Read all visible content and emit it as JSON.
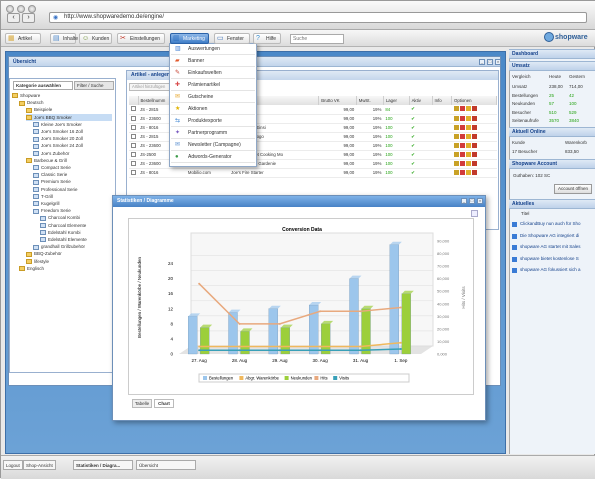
{
  "browser": {
    "url": "http://www.shopwaredemo.de/engine/"
  },
  "toolbar": {
    "items": [
      {
        "label": "Artikel",
        "icon": "box-icon"
      },
      {
        "label": "Inhalte",
        "icon": "doc-icon"
      },
      {
        "label": "Kunden",
        "icon": "users-icon"
      },
      {
        "label": "Einstellungen",
        "icon": "tools-icon"
      },
      {
        "label": "Marketing",
        "icon": "chart-icon"
      },
      {
        "label": "Fenster",
        "icon": "window-icon"
      },
      {
        "label": "Hilfe",
        "icon": "help-icon"
      }
    ],
    "search_placeholder": "Suche",
    "logo": "shopware"
  },
  "marketing_menu": [
    {
      "label": "Auswertungen",
      "icon": "chart-icon",
      "color": "#3b7bd3"
    },
    {
      "label": "Banner",
      "icon": "banner-icon",
      "color": "#e25a2d"
    },
    {
      "label": "Einkaufswelten",
      "icon": "pin-icon",
      "color": "#c43b2a"
    },
    {
      "label": "Prämienartikel",
      "icon": "gift-icon",
      "color": "#d94b4b"
    },
    {
      "label": "Gutscheine",
      "icon": "ticket-icon",
      "color": "#e7a52a"
    },
    {
      "label": "Aktionen",
      "icon": "star-icon",
      "color": "#e2b400"
    },
    {
      "label": "Produktexporte",
      "icon": "export-icon",
      "color": "#3f85d2"
    },
    {
      "label": "Partnerprogramm",
      "icon": "partner-icon",
      "color": "#7a5cc0"
    },
    {
      "label": "Newsletter (Campagne)",
      "icon": "mail-icon",
      "color": "#5a8fd0"
    },
    {
      "label": "Adwords-Generator",
      "icon": "adwords-icon",
      "color": "#3d9b4a"
    }
  ],
  "overview_window": {
    "title": "Übersicht"
  },
  "category_panel": {
    "tab_categories": "Kategorie auswählen",
    "tab_filter": "Filter / Suche",
    "tree": [
      {
        "label": "Shopware",
        "level": 0
      },
      {
        "label": "Deutsch",
        "level": 1
      },
      {
        "label": "Beispiele",
        "level": 2
      },
      {
        "label": "Joe's BBQ Smoker",
        "level": 2
      },
      {
        "label": "Kleine Joe's Smoker",
        "level": 3
      },
      {
        "label": "Joe's Smoker 16 Zoll",
        "level": 3
      },
      {
        "label": "Joe's Smoker 20 Zoll",
        "level": 3
      },
      {
        "label": "Joe's Smoker 24 Zoll",
        "level": 3
      },
      {
        "label": "Joe's Zubehör",
        "level": 3
      },
      {
        "label": "Barbecue & Grill",
        "level": 2
      },
      {
        "label": "Compact Serie",
        "level": 3
      },
      {
        "label": "Classic Serie",
        "level": 3
      },
      {
        "label": "Premium Serie",
        "level": 3
      },
      {
        "label": "Professional Serie",
        "level": 3
      },
      {
        "label": "T-Grill",
        "level": 3
      },
      {
        "label": "Kugelgrill",
        "level": 3
      },
      {
        "label": "Freedom Serie",
        "level": 3
      },
      {
        "label": "Charcoal Kombi",
        "level": 4
      },
      {
        "label": "Charcoal Elemente",
        "level": 4
      },
      {
        "label": "Edelstahl Kombi",
        "level": 4
      },
      {
        "label": "Edelstahl Elemente",
        "level": 4
      },
      {
        "label": "grandhall Grillzubehör",
        "level": 3
      },
      {
        "label": "BBQ-Zubehör",
        "level": 2
      },
      {
        "label": "lifestyle",
        "level": 2
      },
      {
        "label": "Englisch",
        "level": 1
      }
    ]
  },
  "articles": {
    "title": "Artikel - anlegen",
    "add_button": "Artikel hinzufügen",
    "columns": [
      "Bestellnumm",
      "",
      "",
      "Brutto VK",
      "MwSt.",
      "Lager",
      "Aktiv",
      "Info",
      "Optionen"
    ],
    "rows": [
      {
        "nr": "JS - 2815",
        "supplier": "",
        "name": "...tablos",
        "price": "99,00",
        "tax": "19%",
        "stock": "84",
        "active": true
      },
      {
        "nr": "JS - 23600",
        "supplier": "",
        "name": "...ey Joe",
        "price": "99,00",
        "tax": "19%",
        "stock": "100",
        "active": true
      },
      {
        "nr": "JS - 8016",
        "supplier": "",
        "name": "...rkmann für Einsi",
        "price": "99,00",
        "tax": "19%",
        "stock": "100",
        "active": true
      },
      {
        "nr": "JS - 2815",
        "supplier": "",
        "name": "...kbuch mit Logo",
        "price": "99,00",
        "tax": "19%",
        "stock": "100",
        "active": true
      },
      {
        "nr": "JS - 23600",
        "supplier": "",
        "name": "...Grill",
        "price": "99,00",
        "tax": "19%",
        "stock": "100",
        "active": true
      },
      {
        "nr": "JS-2500",
        "supplier": "Mobilio.com",
        "name": "Joe's Gourmet Cooking Mo",
        "price": "99,00",
        "tax": "19%",
        "stock": "100",
        "active": true
      },
      {
        "nr": "JS - 23600",
        "supplier": "Mobilio.com",
        "name": "Joe's Flasche Gardenie",
        "price": "99,00",
        "tax": "19%",
        "stock": "100",
        "active": true
      },
      {
        "nr": "JS - 8016",
        "supplier": "Mobilio.com",
        "name": "Joe's Fire Starter",
        "price": "99,00",
        "tax": "19%",
        "stock": "100",
        "active": true
      }
    ]
  },
  "dashboard": {
    "title": "Dashboard",
    "turnover_title": "Umsatz",
    "turnover_header": [
      "Vergleich",
      "Heute",
      "Gestern"
    ],
    "turnover_rows": [
      [
        "Umsatz",
        "238,00",
        "714,00"
      ],
      [
        "Bestellungen",
        "25",
        "42"
      ],
      [
        "Neukunden",
        "57",
        "100"
      ],
      [
        "Besucher",
        "510",
        "529"
      ],
      [
        "Seitenaufrufe",
        "3570",
        "3840"
      ]
    ],
    "online_title": "Aktuell Online",
    "online_header": [
      "Kunde",
      "Warenkorb"
    ],
    "online_row": [
      "17 Besucher",
      "833,50"
    ],
    "account_title": "Shopware Account",
    "account_credit": "Guthaben: 102 SC",
    "account_button": "Account öffnen",
    "news_title": "Aktuelles",
    "news_header": "Titel",
    "news": [
      "ClickandBuy nun auch für Sho",
      "Die Shopware AG integriert di",
      "shopware AG startet mit Sales",
      "shopware bietet kostenlose S",
      "shopware AG fokussiert sich a"
    ]
  },
  "stats_window": {
    "title": "Statistiken / Diagramme",
    "tab_table": "Tabelle",
    "tab_chart": "Chart"
  },
  "chart_data": {
    "type": "bar",
    "title": "Conversion Data",
    "categories": [
      "27. Aug",
      "28. Aug",
      "29. Aug",
      "30. Aug",
      "31. Aug",
      "1. Sep"
    ],
    "ylabel": "Bestellungen / Warenkörbe / Neukunden",
    "y2label": "Hits / Visits",
    "ylim": [
      0,
      30
    ],
    "y2lim": [
      0,
      90000
    ],
    "yticks": [
      0,
      4,
      8,
      12,
      16,
      20,
      24
    ],
    "y2ticks": [
      "0,000",
      "10,000",
      "20,000",
      "30,000",
      "40,000",
      "50,000",
      "60,000",
      "70,000",
      "80,000",
      "90,000"
    ],
    "series": [
      {
        "name": "Bestellungen",
        "kind": "bar",
        "color": "#9cc6ec",
        "values": [
          10,
          11,
          12,
          13,
          20,
          29
        ]
      },
      {
        "name": "Abgr. Warenkörbe",
        "kind": "line",
        "color": "#f0b85c",
        "values": [
          2,
          2,
          2,
          2,
          2,
          3
        ]
      },
      {
        "name": "Neukunden",
        "kind": "bar",
        "color": "#9ccf3b",
        "values": [
          7,
          6,
          7,
          8,
          12,
          16
        ]
      },
      {
        "name": "Hits",
        "kind": "line",
        "color": "#e8a97e",
        "values": [
          56000,
          24000,
          24000,
          34000,
          34000,
          37000
        ]
      },
      {
        "name": "Visits",
        "kind": "line",
        "color": "#38a0b8",
        "values": [
          3000,
          3000,
          3000,
          3000,
          3000,
          4000
        ]
      }
    ]
  },
  "statusbar": {
    "logout": "Logout",
    "shop": "Shop-Ansicht",
    "task": "Statistiken / Diagra...",
    "view": "Übersicht"
  }
}
